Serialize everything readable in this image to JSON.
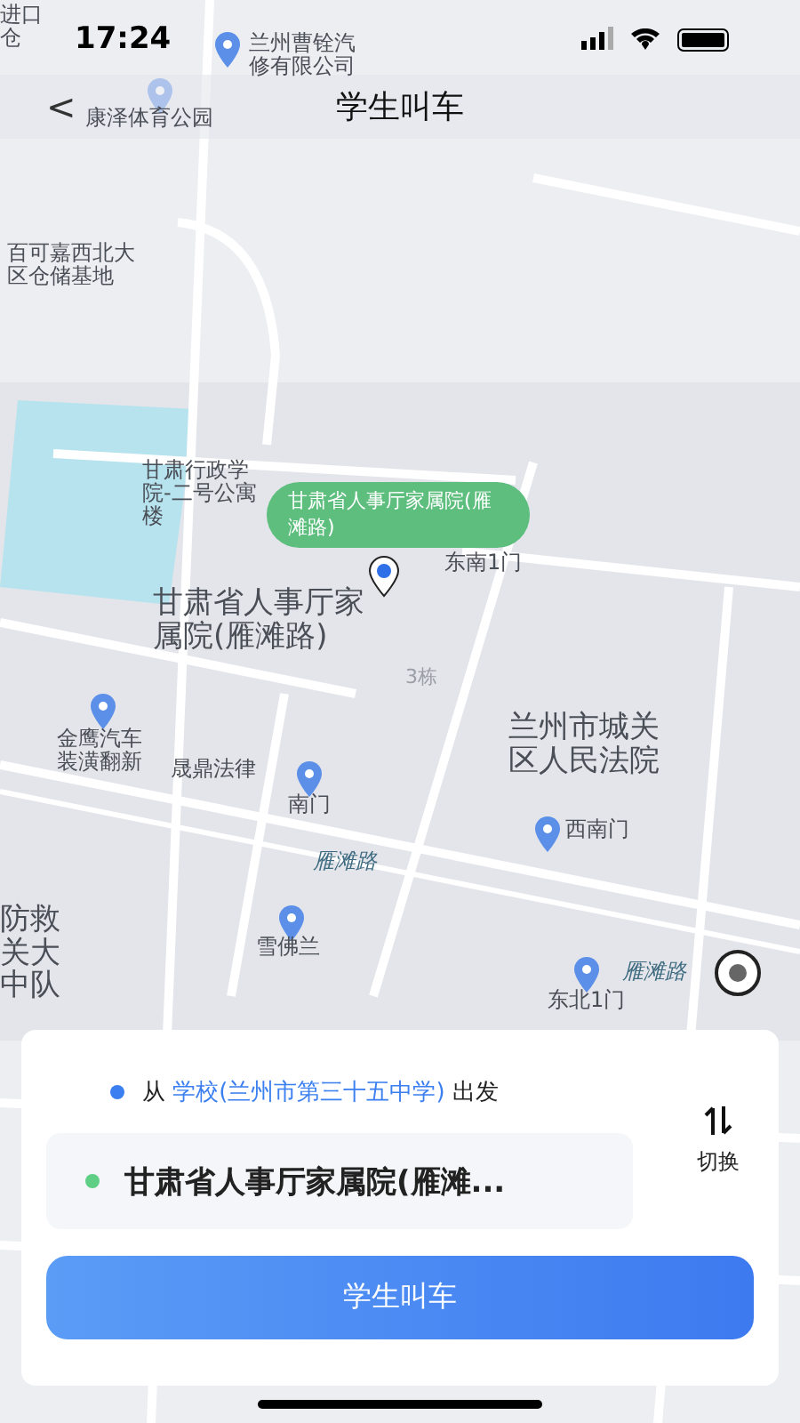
{
  "status_bar": {
    "time": "17:24"
  },
  "nav": {
    "back": "<",
    "title": "学生叫车"
  },
  "map_labels": [
    {
      "text": "进口仓",
      "kind": "poi"
    },
    {
      "text": "兰州曹铨汽修有限公司",
      "kind": "poi"
    },
    {
      "text": "康泽体育公园",
      "kind": "poi"
    },
    {
      "text": "百可嘉西北大区仓储基地",
      "kind": "poi"
    },
    {
      "text": "甘肃行政学院-二号公寓楼",
      "kind": "poi"
    },
    {
      "text": "东南1门",
      "kind": "poi"
    },
    {
      "text": "甘肃省人事厅家属院(雁滩路)",
      "kind": "area"
    },
    {
      "text": "3栋",
      "kind": "minor"
    },
    {
      "text": "金鹰汽车装潢翻新",
      "kind": "poi"
    },
    {
      "text": "晟鼎法律",
      "kind": "poi"
    },
    {
      "text": "南门",
      "kind": "poi"
    },
    {
      "text": "兰州市城关区人民法院",
      "kind": "area"
    },
    {
      "text": "西南门",
      "kind": "poi"
    },
    {
      "text": "雁滩路",
      "kind": "road"
    },
    {
      "text": "防救关大中队",
      "kind": "area"
    },
    {
      "text": "雪佛兰",
      "kind": "poi"
    },
    {
      "text": "雁滩路",
      "kind": "road"
    },
    {
      "text": "东北1门",
      "kind": "poi"
    }
  ],
  "pin": {
    "label": "甘肃省人事厅家属院(雁滩路)"
  },
  "route": {
    "from_prefix": "从",
    "from_place": "学校(兰州市第三十五中学)",
    "from_suffix": "出发",
    "to": "甘肃省人事厅家属院(雁滩...",
    "swap": "切换"
  },
  "button": "学生叫车"
}
